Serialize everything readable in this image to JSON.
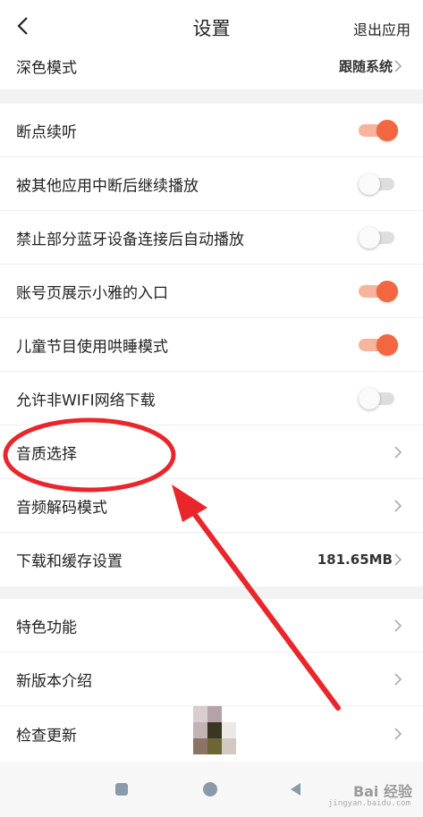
{
  "header": {
    "title": "设置",
    "exit_label": "退出应用"
  },
  "settings": {
    "dark_mode": {
      "label": "深色模式",
      "value": "跟随系统"
    },
    "resume_playback": {
      "label": "断点续听",
      "enabled": true
    },
    "resume_after_interrupt": {
      "label": "被其他应用中断后继续播放",
      "enabled": false
    },
    "block_bluetooth_autoplay": {
      "label": "禁止部分蓝牙设备连接后自动播放",
      "enabled": false
    },
    "show_xiaoya_entry": {
      "label": "账号页展示小雅的入口",
      "enabled": true
    },
    "kids_sleep_mode": {
      "label": "儿童节目使用哄睡模式",
      "enabled": true
    },
    "allow_non_wifi_download": {
      "label": "允许非WIFI网络下载",
      "enabled": false
    },
    "audio_quality": {
      "label": "音质选择"
    },
    "audio_decode_mode": {
      "label": "音频解码模式"
    },
    "download_cache": {
      "label": "下载和缓存设置",
      "value": "181.65MB"
    },
    "features": {
      "label": "特色功能"
    },
    "version_intro": {
      "label": "新版本介绍"
    },
    "check_update": {
      "label": "检查更新"
    }
  },
  "watermark": {
    "brand": "Bai 经验",
    "url": "jingyan.baidu.com"
  },
  "colors": {
    "accent": "#f26740",
    "annotation_red": "#e8262b",
    "section_gap": "#f2f2f2"
  },
  "icons": {
    "back": "chevron-left-icon",
    "chevron": "chevron-right-icon",
    "nav_recent": "square-icon",
    "nav_home": "circle-icon",
    "nav_back": "triangle-icon"
  }
}
